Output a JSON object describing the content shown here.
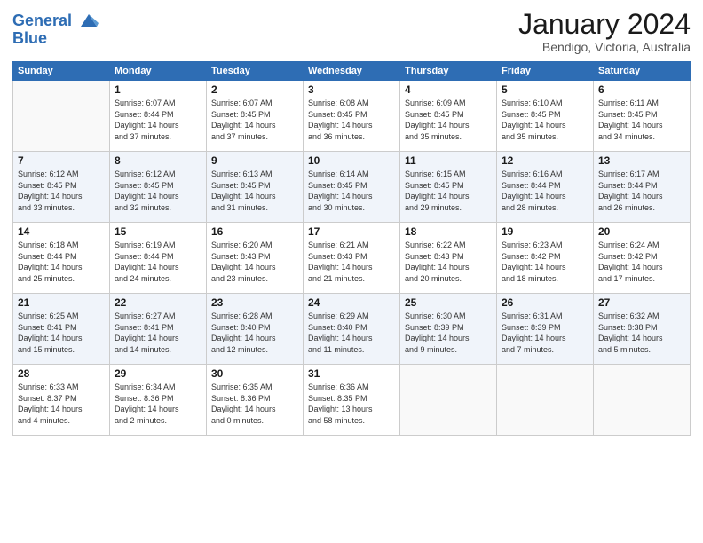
{
  "logo": {
    "line1": "General",
    "line2": "Blue"
  },
  "title": "January 2024",
  "subtitle": "Bendigo, Victoria, Australia",
  "days_of_week": [
    "Sunday",
    "Monday",
    "Tuesday",
    "Wednesday",
    "Thursday",
    "Friday",
    "Saturday"
  ],
  "weeks": [
    [
      {
        "day": "",
        "empty": true
      },
      {
        "day": "1",
        "sunrise": "6:07 AM",
        "sunset": "8:44 PM",
        "daylight": "14 hours and 37 minutes."
      },
      {
        "day": "2",
        "sunrise": "6:07 AM",
        "sunset": "8:45 PM",
        "daylight": "14 hours and 37 minutes."
      },
      {
        "day": "3",
        "sunrise": "6:08 AM",
        "sunset": "8:45 PM",
        "daylight": "14 hours and 36 minutes."
      },
      {
        "day": "4",
        "sunrise": "6:09 AM",
        "sunset": "8:45 PM",
        "daylight": "14 hours and 35 minutes."
      },
      {
        "day": "5",
        "sunrise": "6:10 AM",
        "sunset": "8:45 PM",
        "daylight": "14 hours and 35 minutes."
      },
      {
        "day": "6",
        "sunrise": "6:11 AM",
        "sunset": "8:45 PM",
        "daylight": "14 hours and 34 minutes."
      }
    ],
    [
      {
        "day": "7",
        "sunrise": "6:12 AM",
        "sunset": "8:45 PM",
        "daylight": "14 hours and 33 minutes."
      },
      {
        "day": "8",
        "sunrise": "6:12 AM",
        "sunset": "8:45 PM",
        "daylight": "14 hours and 32 minutes."
      },
      {
        "day": "9",
        "sunrise": "6:13 AM",
        "sunset": "8:45 PM",
        "daylight": "14 hours and 31 minutes."
      },
      {
        "day": "10",
        "sunrise": "6:14 AM",
        "sunset": "8:45 PM",
        "daylight": "14 hours and 30 minutes."
      },
      {
        "day": "11",
        "sunrise": "6:15 AM",
        "sunset": "8:45 PM",
        "daylight": "14 hours and 29 minutes."
      },
      {
        "day": "12",
        "sunrise": "6:16 AM",
        "sunset": "8:44 PM",
        "daylight": "14 hours and 28 minutes."
      },
      {
        "day": "13",
        "sunrise": "6:17 AM",
        "sunset": "8:44 PM",
        "daylight": "14 hours and 26 minutes."
      }
    ],
    [
      {
        "day": "14",
        "sunrise": "6:18 AM",
        "sunset": "8:44 PM",
        "daylight": "14 hours and 25 minutes."
      },
      {
        "day": "15",
        "sunrise": "6:19 AM",
        "sunset": "8:44 PM",
        "daylight": "14 hours and 24 minutes."
      },
      {
        "day": "16",
        "sunrise": "6:20 AM",
        "sunset": "8:43 PM",
        "daylight": "14 hours and 23 minutes."
      },
      {
        "day": "17",
        "sunrise": "6:21 AM",
        "sunset": "8:43 PM",
        "daylight": "14 hours and 21 minutes."
      },
      {
        "day": "18",
        "sunrise": "6:22 AM",
        "sunset": "8:43 PM",
        "daylight": "14 hours and 20 minutes."
      },
      {
        "day": "19",
        "sunrise": "6:23 AM",
        "sunset": "8:42 PM",
        "daylight": "14 hours and 18 minutes."
      },
      {
        "day": "20",
        "sunrise": "6:24 AM",
        "sunset": "8:42 PM",
        "daylight": "14 hours and 17 minutes."
      }
    ],
    [
      {
        "day": "21",
        "sunrise": "6:25 AM",
        "sunset": "8:41 PM",
        "daylight": "14 hours and 15 minutes."
      },
      {
        "day": "22",
        "sunrise": "6:27 AM",
        "sunset": "8:41 PM",
        "daylight": "14 hours and 14 minutes."
      },
      {
        "day": "23",
        "sunrise": "6:28 AM",
        "sunset": "8:40 PM",
        "daylight": "14 hours and 12 minutes."
      },
      {
        "day": "24",
        "sunrise": "6:29 AM",
        "sunset": "8:40 PM",
        "daylight": "14 hours and 11 minutes."
      },
      {
        "day": "25",
        "sunrise": "6:30 AM",
        "sunset": "8:39 PM",
        "daylight": "14 hours and 9 minutes."
      },
      {
        "day": "26",
        "sunrise": "6:31 AM",
        "sunset": "8:39 PM",
        "daylight": "14 hours and 7 minutes."
      },
      {
        "day": "27",
        "sunrise": "6:32 AM",
        "sunset": "8:38 PM",
        "daylight": "14 hours and 5 minutes."
      }
    ],
    [
      {
        "day": "28",
        "sunrise": "6:33 AM",
        "sunset": "8:37 PM",
        "daylight": "14 hours and 4 minutes."
      },
      {
        "day": "29",
        "sunrise": "6:34 AM",
        "sunset": "8:36 PM",
        "daylight": "14 hours and 2 minutes."
      },
      {
        "day": "30",
        "sunrise": "6:35 AM",
        "sunset": "8:36 PM",
        "daylight": "14 hours and 0 minutes."
      },
      {
        "day": "31",
        "sunrise": "6:36 AM",
        "sunset": "8:35 PM",
        "daylight": "13 hours and 58 minutes."
      },
      {
        "day": "",
        "empty": true
      },
      {
        "day": "",
        "empty": true
      },
      {
        "day": "",
        "empty": true
      }
    ]
  ]
}
